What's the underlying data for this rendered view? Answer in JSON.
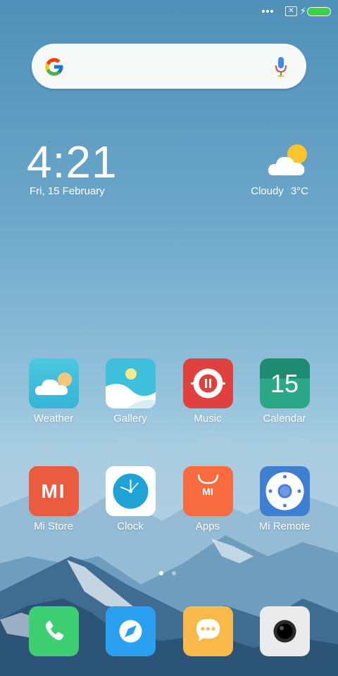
{
  "status_bar": {
    "sim_glyph": "✕",
    "battery_level_percent": 100,
    "battery_color": "#3fd04a"
  },
  "search": {
    "placeholder": "",
    "icon_left": "google-g-icon",
    "icon_right": "microphone-icon"
  },
  "clock_widget": {
    "time": "4:21",
    "date": "Fri, 15 February"
  },
  "weather_widget": {
    "condition": "Cloudy",
    "temperature": "3°C",
    "icon": "cloud-sun-icon"
  },
  "apps": [
    {
      "label": "Weather",
      "icon": "weather-icon"
    },
    {
      "label": "Gallery",
      "icon": "gallery-icon"
    },
    {
      "label": "Music",
      "icon": "music-icon"
    },
    {
      "label": "Calendar",
      "icon": "calendar-icon",
      "badge_text": "15"
    },
    {
      "label": "Mi Store",
      "icon": "mi-store-icon",
      "logo_text": "MI"
    },
    {
      "label": "Clock",
      "icon": "clock-icon"
    },
    {
      "label": "Apps",
      "icon": "apps-icon",
      "logo_text": "MI"
    },
    {
      "label": "Mi Remote",
      "icon": "mi-remote-icon"
    }
  ],
  "dock": [
    {
      "icon": "phone-icon",
      "color": "#3dcf72"
    },
    {
      "icon": "browser-icon",
      "color": "#2b9ff0"
    },
    {
      "icon": "messaging-icon",
      "color": "#f8b94a"
    },
    {
      "icon": "camera-icon",
      "color": "#ebebeb"
    }
  ],
  "page_indicator": {
    "pages": 2,
    "current": 1
  }
}
